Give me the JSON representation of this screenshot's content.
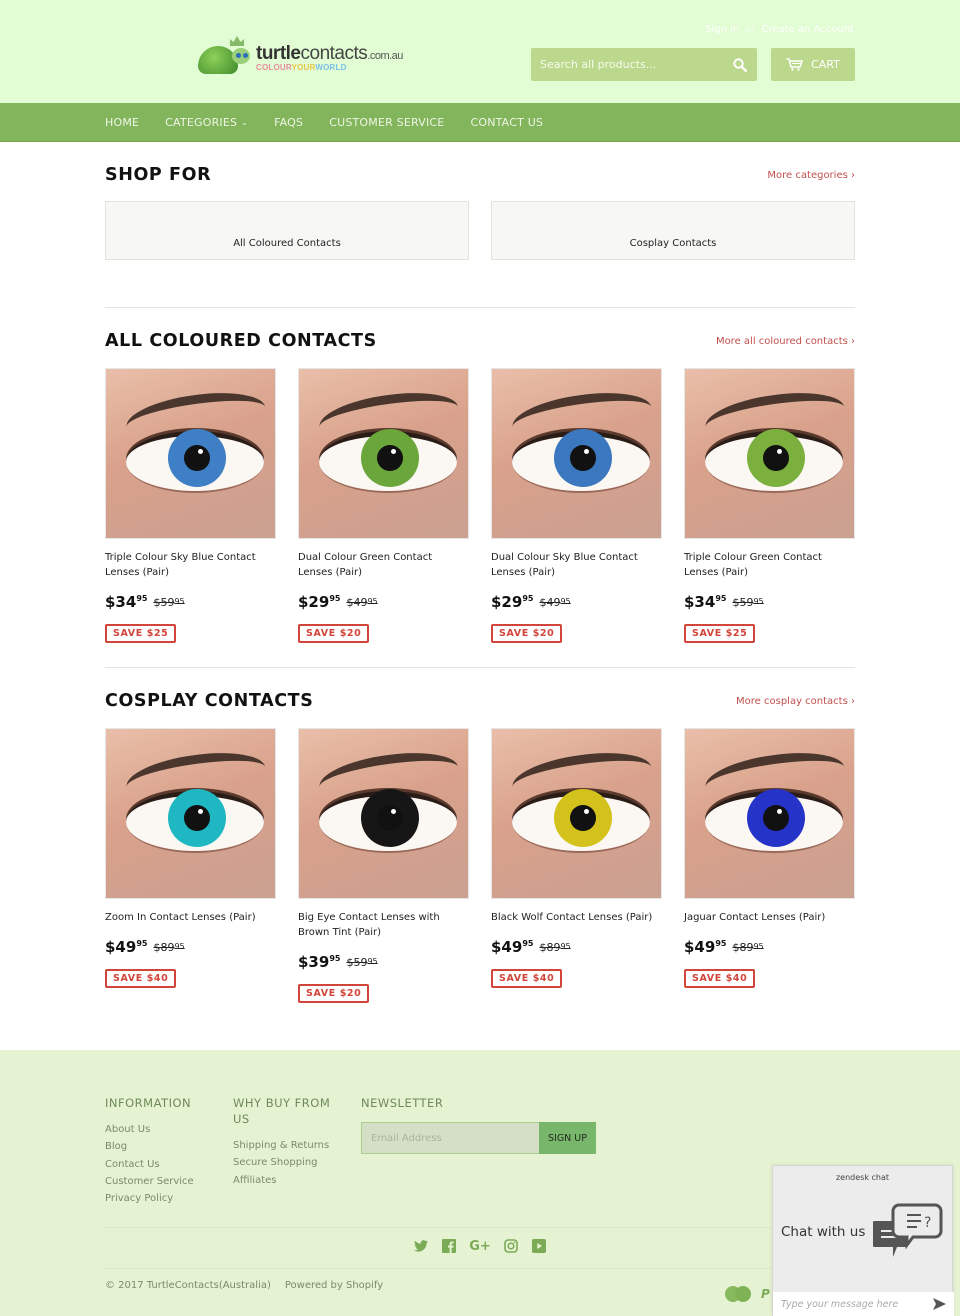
{
  "header": {
    "logo": {
      "brand_bold": "turtle",
      "brand_light": "contacts",
      "domain": ".com.au",
      "tagline": [
        "COLOUR",
        "YOUR",
        "WORLD"
      ]
    },
    "account": {
      "sign_in": "Sign in",
      "separator": "or",
      "create_account": "Create an Account"
    },
    "search": {
      "placeholder": "Search all products...",
      "icon": "search-icon"
    },
    "cart": {
      "label": "CART",
      "icon": "cart-icon"
    }
  },
  "nav": {
    "items": [
      {
        "label": "HOME"
      },
      {
        "label": "CATEGORIES",
        "has_dropdown": true
      },
      {
        "label": "FAQS"
      },
      {
        "label": "CUSTOMER SERVICE"
      },
      {
        "label": "CONTACT US"
      }
    ]
  },
  "shop_for": {
    "title": "SHOP FOR",
    "more_link": "More categories ›",
    "categories": [
      {
        "label": "All Coloured Contacts"
      },
      {
        "label": "Cosplay Contacts"
      }
    ]
  },
  "sections": [
    {
      "title": "ALL COLOURED CONTACTS",
      "more_link": "More all coloured contacts ›",
      "products": [
        {
          "title": "Triple Colour Sky Blue Contact Lenses (Pair)",
          "price_main": "$34",
          "price_cents": "95",
          "was_main": "$59",
          "was_cents": "95",
          "save": "SAVE $25",
          "iris_color": "#3f7fc6"
        },
        {
          "title": "Dual Colour Green Contact Lenses (Pair)",
          "price_main": "$29",
          "price_cents": "95",
          "was_main": "$49",
          "was_cents": "95",
          "save": "SAVE $20",
          "iris_color": "#6aa63a"
        },
        {
          "title": "Dual Colour Sky Blue Contact Lenses (Pair)",
          "price_main": "$29",
          "price_cents": "95",
          "was_main": "$49",
          "was_cents": "95",
          "save": "SAVE $20",
          "iris_color": "#3c78bf"
        },
        {
          "title": "Triple Colour Green Contact Lenses (Pair)",
          "price_main": "$34",
          "price_cents": "95",
          "was_main": "$59",
          "was_cents": "95",
          "save": "SAVE $25",
          "iris_color": "#7bb03f"
        }
      ]
    },
    {
      "title": "COSPLAY CONTACTS",
      "more_link": "More cosplay contacts ›",
      "products": [
        {
          "title": "Zoom In Contact Lenses (Pair)",
          "price_main": "$49",
          "price_cents": "95",
          "was_main": "$89",
          "was_cents": "95",
          "save": "SAVE $40",
          "iris_color": "#1fb8c2"
        },
        {
          "title": "Big Eye Contact Lenses with Brown Tint (Pair)",
          "price_main": "$39",
          "price_cents": "95",
          "was_main": "$59",
          "was_cents": "95",
          "save": "SAVE $20",
          "iris_color": "#161616"
        },
        {
          "title": "Black Wolf Contact Lenses (Pair)",
          "price_main": "$49",
          "price_cents": "95",
          "was_main": "$89",
          "was_cents": "95",
          "save": "SAVE $40",
          "iris_color": "#d4c21c"
        },
        {
          "title": "Jaguar Contact Lenses (Pair)",
          "price_main": "$49",
          "price_cents": "95",
          "was_main": "$89",
          "was_cents": "95",
          "save": "SAVE $40",
          "iris_color": "#2633c8"
        }
      ]
    }
  ],
  "footer": {
    "information": {
      "title": "INFORMATION",
      "links": [
        "About Us",
        "Blog",
        "Contact Us",
        "Customer Service",
        "Privacy Policy"
      ]
    },
    "why_buy": {
      "title": "WHY BUY FROM US",
      "links": [
        "Shipping & Returns",
        "Secure Shopping",
        "Affiliates"
      ]
    },
    "newsletter": {
      "title": "NEWSLETTER",
      "placeholder": "Email Address",
      "button": "SIGN UP"
    },
    "social": [
      "twitter-icon",
      "facebook-icon",
      "google-plus-icon",
      "instagram-icon",
      "youtube-icon"
    ],
    "copyright": "© 2017 TurtleContacts(Australia)",
    "powered_by": "Powered by Shopify",
    "payment": [
      "mastercard-icon",
      "paypal-icon"
    ]
  },
  "chat": {
    "brand": "zendesk chat",
    "title": "Chat with us",
    "placeholder": "Type your message here"
  },
  "colors": {
    "header_bg": "#e2fcd3",
    "nav_bg": "#83b55d",
    "accent_red": "#d1453b",
    "footer_bg": "#e6f3d3"
  }
}
